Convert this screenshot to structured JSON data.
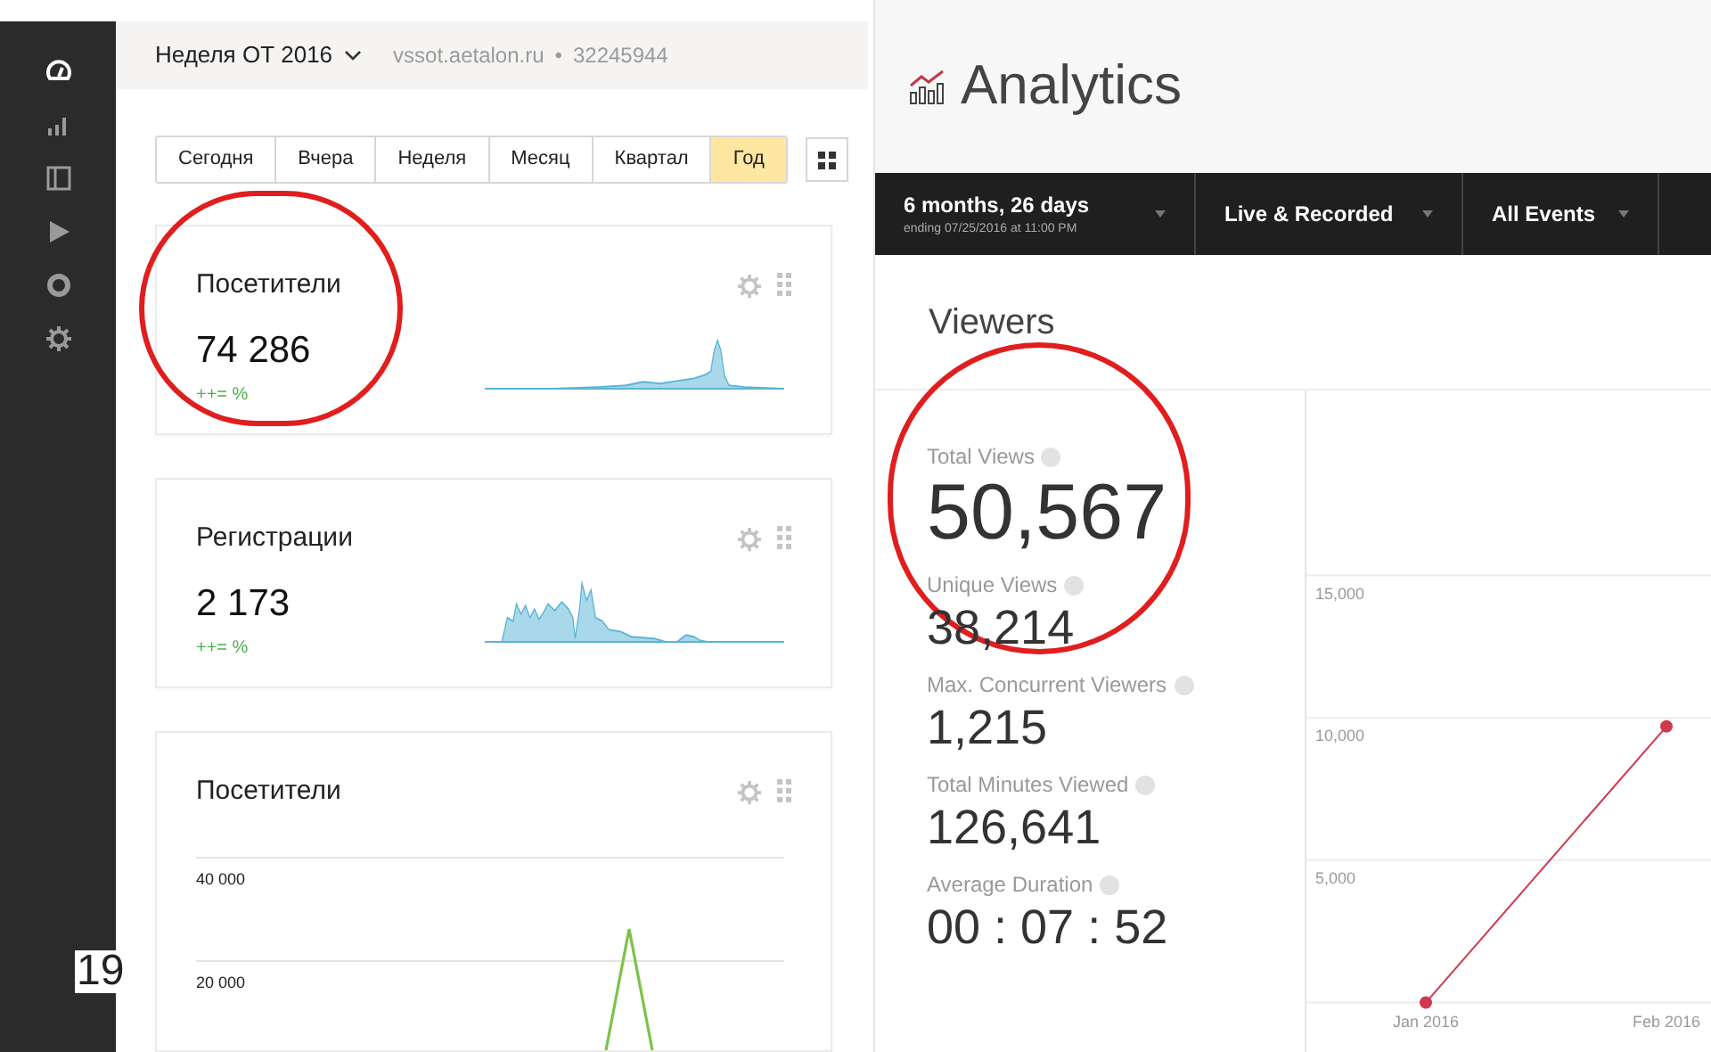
{
  "left_app": {
    "sidebar": {
      "items": [
        {
          "kind": "gauge",
          "selected": true
        },
        {
          "kind": "bars",
          "selected": false
        },
        {
          "kind": "panel",
          "selected": false
        },
        {
          "kind": "play",
          "selected": false
        },
        {
          "kind": "circle",
          "selected": false
        },
        {
          "kind": "gear",
          "selected": false
        }
      ]
    },
    "header": {
      "counter": "Неделя ОТ 2016",
      "site": "vssot.aetalon.ru",
      "separator": "•",
      "id": "32245944"
    },
    "periods": [
      {
        "label": "Сегодня",
        "selected": false
      },
      {
        "label": "Вчера",
        "selected": false
      },
      {
        "label": "Неделя",
        "selected": false
      },
      {
        "label": "Месяц",
        "selected": false
      },
      {
        "label": "Квартал",
        "selected": false
      },
      {
        "label": "Год",
        "selected": true
      }
    ],
    "widgets": [
      {
        "kind": "sparkline",
        "title": "Посетители",
        "value": "74 286",
        "delta": "++= %",
        "highlighted": true
      },
      {
        "kind": "sparkline",
        "title": "Регистрации",
        "value": "2 173",
        "delta": "++= %"
      },
      {
        "kind": "chart",
        "title": "Посетители",
        "axis_labels": [
          "40 000",
          "20 000"
        ]
      }
    ]
  },
  "right_app": {
    "title": "Analytics",
    "filters": [
      {
        "label": "6 months, 26 days",
        "sub": "ending 07/25/2016 at 11:00 PM"
      },
      {
        "label": "Live & Recorded"
      },
      {
        "label": "All Events"
      }
    ],
    "section": "Viewers",
    "stats": [
      {
        "label": "Total Views",
        "value": "50,567",
        "highlighted": true
      },
      {
        "label": "Unique Views",
        "value": "38,214"
      },
      {
        "label": "Max. Concurrent Viewers",
        "value": "1,215"
      },
      {
        "label": "Total Minutes Viewed",
        "value": "126,641"
      },
      {
        "label": "Average Duration",
        "value": "00 : 07 : 52"
      }
    ],
    "chart_data": {
      "type": "line",
      "ylim": [
        -1800,
        21500
      ],
      "grid": true,
      "categories": [
        "Jan 2016",
        "Feb 2016"
      ],
      "yticks": [
        {
          "value": 5000,
          "label": "5,000"
        },
        {
          "value": 10000,
          "label": "10,000"
        },
        {
          "value": 15000,
          "label": "15,000"
        }
      ],
      "series": [
        {
          "color": "#d0384e",
          "marker": "circle",
          "values": [
            0,
            9700
          ]
        }
      ]
    }
  },
  "slide_number": "19"
}
